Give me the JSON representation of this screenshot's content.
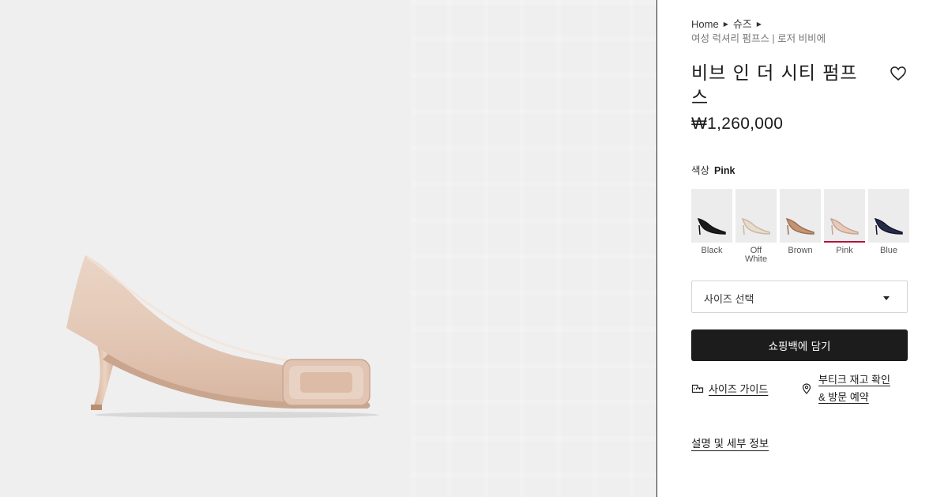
{
  "breadcrumb": {
    "home": "Home",
    "category": "슈즈",
    "sub": "여성 럭셔리 펌프스 | 로저 비비에"
  },
  "product": {
    "title": "비브 인 더 시티 펌프스",
    "price": "₩1,260,000",
    "image_icon": "pink-pump-shoe-image"
  },
  "color": {
    "label": "색상",
    "selected": "Pink",
    "options": [
      {
        "line1": "Black",
        "line2": "",
        "color": "#1b1b1b"
      },
      {
        "line1": "Off",
        "line2": "White",
        "color": "#e9dccd"
      },
      {
        "line1": "Brown",
        "line2": "",
        "color": "#c49473"
      },
      {
        "line1": "Pink",
        "line2": "",
        "color": "#e6cbbb"
      },
      {
        "line1": "Blue",
        "line2": "",
        "color": "#252a45"
      }
    ],
    "active_accent": "#b3123a"
  },
  "size": {
    "placeholder": "사이즈 선택"
  },
  "actions": {
    "add_to_bag": "쇼핑백에 담기",
    "size_guide": "사이즈 가이드",
    "boutique_line1": "부티크 재고 확인",
    "boutique_line2": "& 방문 예약",
    "details": "설명 및 세부 정보"
  },
  "icons": {
    "wishlist": "heart-icon",
    "size_guide": "ruler-icon",
    "boutique": "location-pin-icon",
    "select_caret": "caret-down-icon",
    "breadcrumb_separator": "triangle-right-icon"
  }
}
